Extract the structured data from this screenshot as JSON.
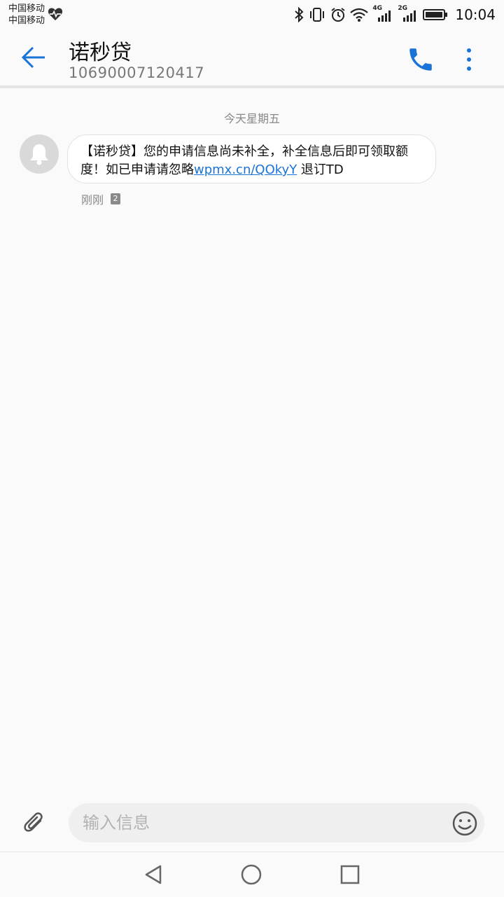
{
  "status_bar": {
    "carrier_1": "中国移动",
    "carrier_2": "中国移动",
    "network_1": "4G",
    "network_2": "2G",
    "time": "10:04"
  },
  "header": {
    "title": "诺秒贷",
    "subtitle": "10690007120417"
  },
  "conversation": {
    "date_label": "今天星期五",
    "message": {
      "text_before_link": "【诺秒贷】您的申请信息尚未补全，补全信息后即可领取额度！如已申请请忽略",
      "link": "wpmx.cn/QOkyY",
      "text_after_link": " 退订TD",
      "time": "刚刚",
      "sim_slot": "2"
    }
  },
  "composer": {
    "placeholder": "输入信息"
  },
  "colors": {
    "accent": "#1a73d6",
    "background": "#fafafa"
  }
}
